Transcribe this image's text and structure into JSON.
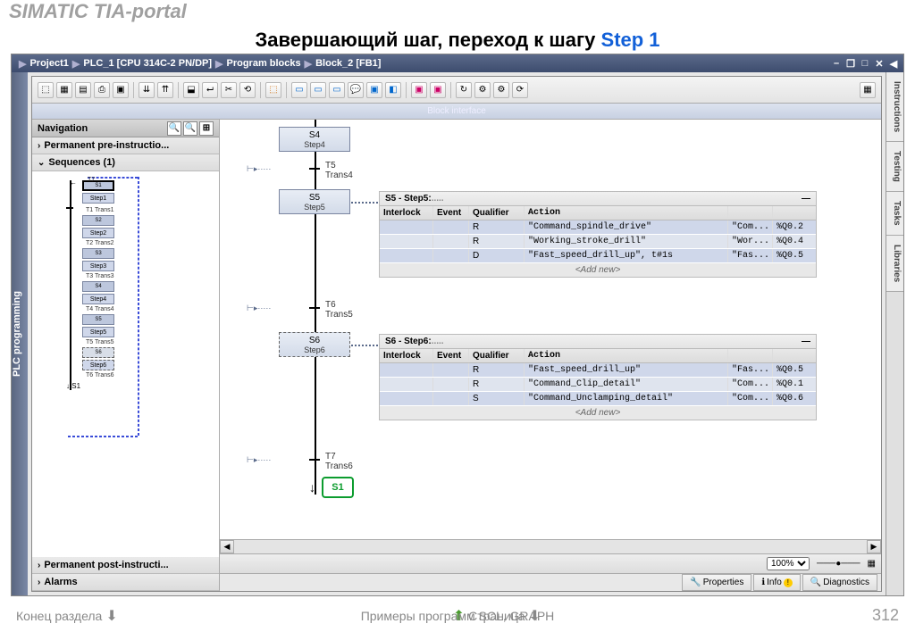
{
  "header": "SIMATIC TIA-portal",
  "title_black": "Завершающий шаг, переход к шагу ",
  "title_blue": "Step 1",
  "breadcrumb": [
    "Project1",
    "PLC_1 [CPU 314C-2 PN/DP]",
    "Program blocks",
    "Block_2 [FB1]"
  ],
  "left_rail": "PLC programming",
  "block_interface": "Block interface",
  "right_tabs": [
    "Instructions",
    "Testing",
    "Tasks",
    "Libraries"
  ],
  "nav_title": "Navigation",
  "nav_items": {
    "pre": "Permanent pre-instructio...",
    "seq": "Sequences (1)",
    "post": "Permanent post-instructi...",
    "alarms": "Alarms"
  },
  "mini": {
    "steps": [
      "Step1",
      "Step2",
      "Step3",
      "Step4",
      "Step5",
      "Step6"
    ],
    "trans": [
      "Trans1",
      "Trans2",
      "Trans3",
      "Trans4",
      "Trans5",
      "Trans6"
    ],
    "snums": [
      "S1",
      "S2",
      "S3",
      "S4",
      "S5",
      "S6",
      "S1"
    ],
    "tnums": [
      "T1",
      "T2",
      "T3",
      "T4",
      "T5",
      "T6",
      "T7"
    ]
  },
  "steps": [
    {
      "id": "S4",
      "name": "Step4"
    },
    {
      "id": "S5",
      "name": "Step5"
    },
    {
      "id": "S6",
      "name": "Step6"
    }
  ],
  "trans": [
    {
      "id": "T5",
      "name": "Trans4"
    },
    {
      "id": "T6",
      "name": "Trans5"
    },
    {
      "id": "T7",
      "name": "Trans6"
    }
  ],
  "jump": "S1",
  "action_blocks": [
    {
      "title": "S5 - Step5:",
      "headers": [
        "Interlock",
        "Event",
        "Qualifier",
        "Action"
      ],
      "rows": [
        {
          "q": "R",
          "act": "\"Command_spindle_drive\"",
          "c": "\"Com...",
          "addr": "%Q0.2"
        },
        {
          "q": "R",
          "act": "\"Working_stroke_drill\"",
          "c": "\"Wor...",
          "addr": "%Q0.4"
        },
        {
          "q": "D",
          "act": "\"Fast_speed_drill_up\", t#1s",
          "c": "\"Fas...",
          "addr": "%Q0.5"
        }
      ],
      "addnew": "<Add new>"
    },
    {
      "title": "S6 - Step6:",
      "headers": [
        "Interlock",
        "Event",
        "Qualifier",
        "Action"
      ],
      "rows": [
        {
          "q": "R",
          "act": "\"Fast_speed_drill_up\"",
          "c": "\"Fas...",
          "addr": "%Q0.5"
        },
        {
          "q": "R",
          "act": "\"Command_Clip_detail\"",
          "c": "\"Com...",
          "addr": "%Q0.1"
        },
        {
          "q": "S",
          "act": "\"Command_Unclamping_detail\"",
          "c": "\"Com...",
          "addr": "%Q0.6"
        }
      ],
      "addnew": "<Add new>"
    }
  ],
  "zoom": "100%",
  "status_tabs": {
    "props": "Properties",
    "info": "Info",
    "diag": "Diagnostics"
  },
  "footer": {
    "left": "Конец раздела",
    "mid": "Примеры программ SCL, GRAPH",
    "right": "Страница",
    "page": "312"
  }
}
